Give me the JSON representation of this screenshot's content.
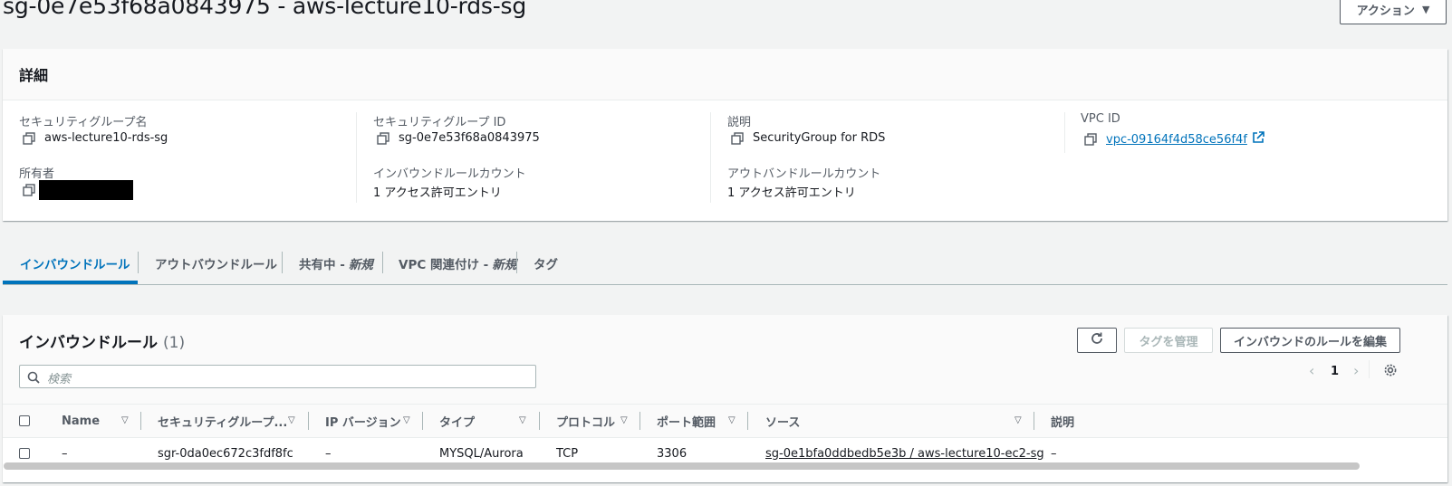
{
  "page": {
    "title": "sg-0e7e53f68a0843975 - aws-lecture10-rds-sg"
  },
  "actions": {
    "label": "アクション"
  },
  "details": {
    "heading": "詳細",
    "sg_name_label": "セキュリティグループ名",
    "sg_name_value": "aws-lecture10-rds-sg",
    "sg_id_label": "セキュリティグループ ID",
    "sg_id_value": "sg-0e7e53f68a0843975",
    "desc_label": "説明",
    "desc_value": "SecurityGroup for RDS",
    "vpc_label": "VPC ID",
    "vpc_value": "vpc-09164f4d58ce56f4f",
    "owner_label": "所有者",
    "inbound_count_label": "インバウンドルールカウント",
    "inbound_count_value": "1 アクセス許可エントリ",
    "outbound_count_label": "アウトバンドルールカウント",
    "outbound_count_value": "1 アクセス許可エントリ"
  },
  "tabs": {
    "inbound": "インバウンドルール",
    "outbound": "アウトバウンドルール",
    "sharing": "共有中 -",
    "sharing_new": "新規",
    "vpc_assoc": "VPC 関連付け -",
    "vpc_assoc_new": "新規",
    "tags": "タグ"
  },
  "rules": {
    "title": "インバウンドルール",
    "count": "(1)",
    "manage_tags": "タグを管理",
    "edit_inbound": "インバウンドのルールを編集",
    "search_placeholder": "検索",
    "page_number": "1",
    "columns": [
      "Name",
      "セキュリティグループ...",
      "IP バージョン",
      "タイプ",
      "プロトコル",
      "ポート範囲",
      "ソース",
      "説明"
    ],
    "rows": [
      {
        "name": "–",
        "rule_id": "sgr-0da0ec672c3fdf8fc",
        "ip_version": "–",
        "type": "MYSQL/Aurora",
        "protocol": "TCP",
        "port": "3306",
        "source": "sg-0e1bfa0ddbedb5e3b / aws-lecture10-ec2-sg",
        "description": "–"
      }
    ]
  },
  "colors": {
    "accent": "#0073bb",
    "text": "#16191f",
    "muted": "#545b64",
    "background": "#f2f3f3"
  }
}
